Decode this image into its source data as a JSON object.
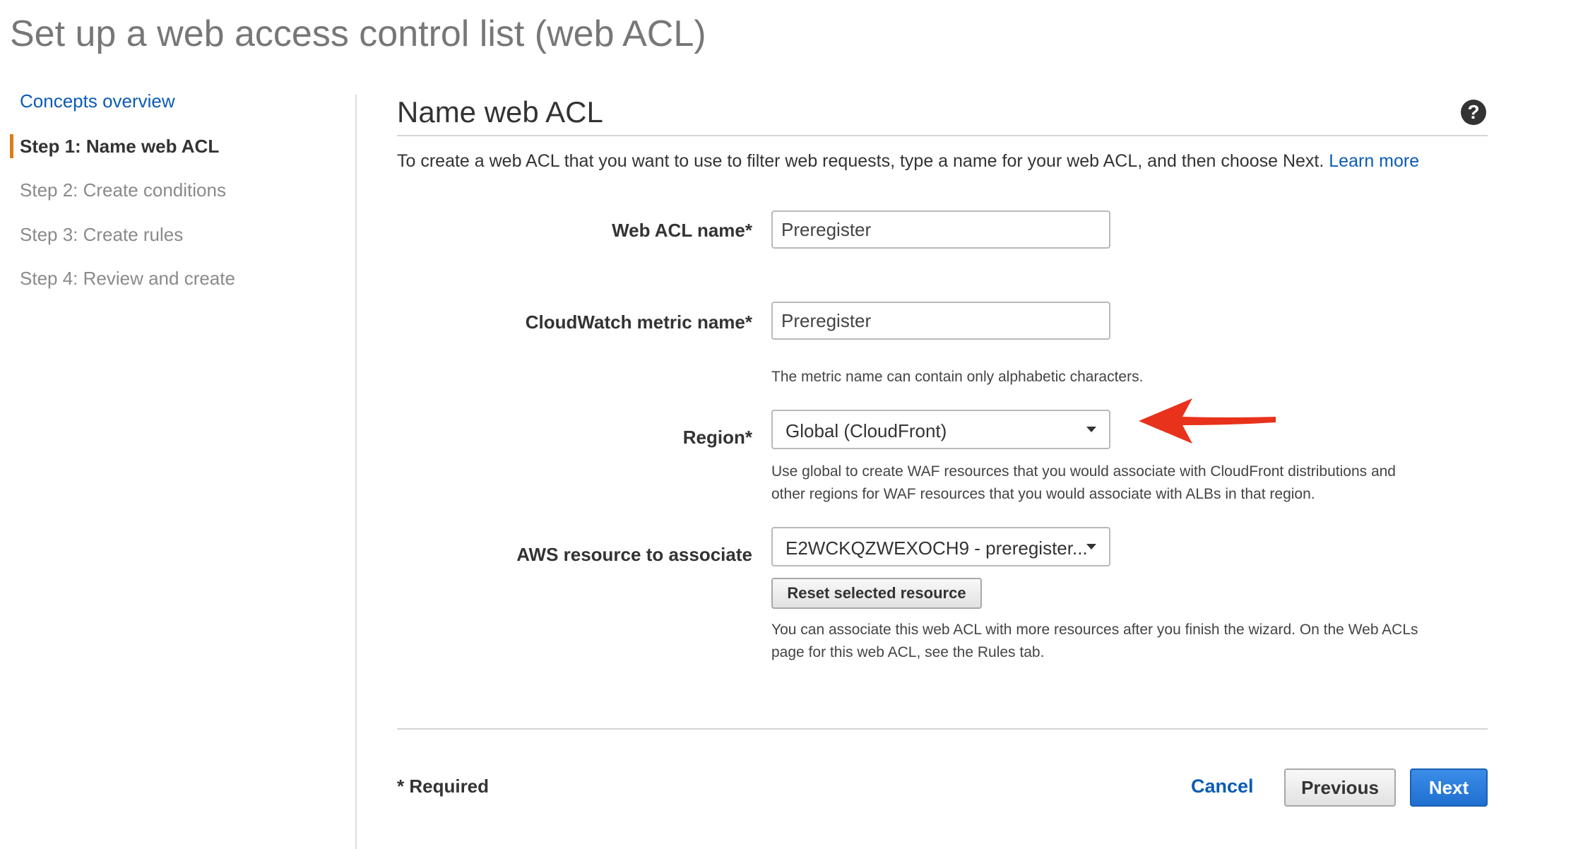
{
  "page": {
    "title": "Set up a web access control list (web ACL)"
  },
  "sidebar": {
    "items": [
      {
        "label": "Concepts overview",
        "state": "link"
      },
      {
        "label": "Step 1: Name web ACL",
        "state": "active"
      },
      {
        "label": "Step 2: Create conditions",
        "state": "inactive"
      },
      {
        "label": "Step 3: Create rules",
        "state": "inactive"
      },
      {
        "label": "Step 4: Review and create",
        "state": "inactive"
      }
    ]
  },
  "main": {
    "section_title": "Name web ACL",
    "help_icon": "question-circle-icon",
    "intro_text": "To create a web ACL that you want to use to filter web requests, type a name for your web ACL, and then choose Next.",
    "learn_more": "Learn more",
    "fields": {
      "web_acl_name": {
        "label": "Web ACL name*",
        "value": "Preregister"
      },
      "metric_name": {
        "label": "CloudWatch metric name*",
        "value": "Preregister",
        "hint": "The metric name can contain only alphabetic characters."
      },
      "region": {
        "label": "Region*",
        "value": "Global (CloudFront)",
        "hint_line1": "Use global to create WAF resources that you would associate with CloudFront distributions and",
        "hint_line2": "other regions for WAF resources that you would associate with ALBs in that region."
      },
      "resource": {
        "label": "AWS resource to associate",
        "value": "E2WCKQZWEXOCH9 - preregister...",
        "reset_label": "Reset selected resource",
        "hint_line1": "You can associate this web ACL with more resources after you finish the wizard. On the Web ACLs",
        "hint_line2": "page for this web ACL, see the Rules tab."
      }
    }
  },
  "footer": {
    "required_note": "* Required",
    "cancel_label": "Cancel",
    "previous_label": "Previous",
    "next_label": "Next"
  },
  "colors": {
    "link": "#0b5bb5",
    "active_marker": "#e07b1a",
    "primary_button": "#1f6fd0",
    "annotation_arrow": "#e8321c"
  }
}
